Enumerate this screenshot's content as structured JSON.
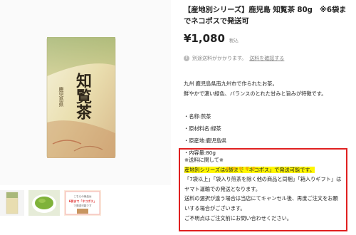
{
  "product": {
    "title": "【産地別シリーズ】鹿児島 知覧茶 80g　※6袋までネコポスで発送可",
    "price": "¥1,080",
    "tax_label": "税込",
    "shipping_note": "別途送料がかかります。",
    "shipping_link": "送料を確認する",
    "package_label_small": "鹿児島県",
    "package_label_main": "知覧茶"
  },
  "description": {
    "line1": "九州 鹿児島県南九州市で作られたお茶。",
    "line2": "鮮やかで濃い緑色、バランスのとれた甘みと旨みが特徴です。"
  },
  "specs": [
    "・名称:煎茶",
    "・原材料名:緑茶",
    "・原産地:鹿児島県",
    "・内容量:80g"
  ],
  "notice": {
    "heading": "※送料に関して※",
    "highlight": "産地別シリーズは6袋まで「ネコポス」で発送可能です。",
    "line2": "「7袋以上」「袋入り煎茶を除く他の商品と同梱」「箱入りギフト」はヤマト運輸での発送となります。",
    "line3": "送料の選択が違う場合は当店にてキャンセル後、再度ご注文をお願いする場合がございます。",
    "line4": "ご不明点はご注文前にお問い合わせください。"
  },
  "thumb3": {
    "line1": "こちらの商品は",
    "line2": "6袋まで「ネコポス」",
    "line3": "で発送可能です"
  },
  "colors": {
    "notice_border": "#e02020",
    "highlight": "#fff600"
  }
}
